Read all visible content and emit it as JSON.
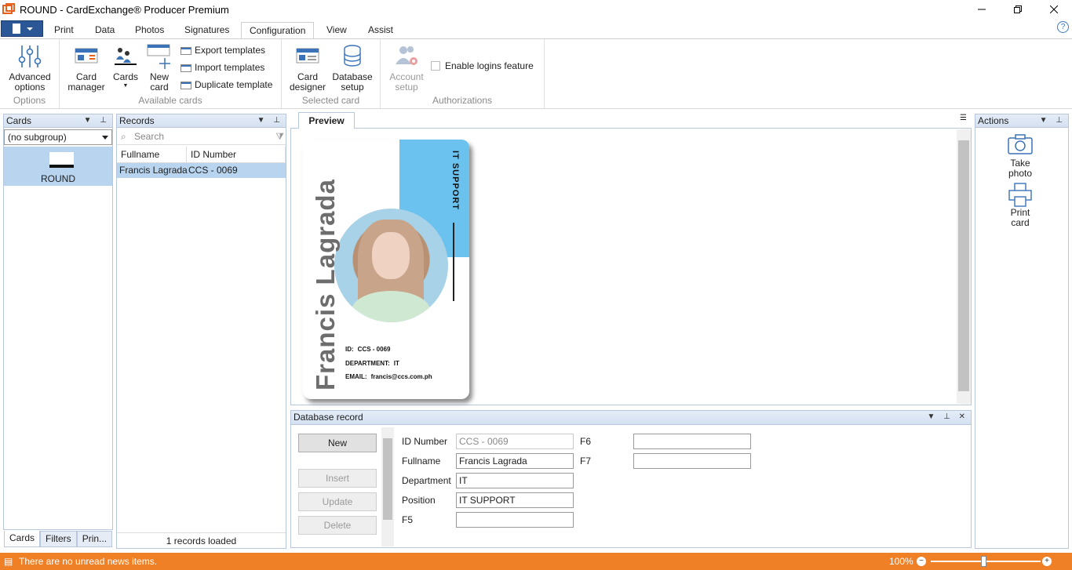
{
  "window": {
    "title": "ROUND - CardExchange® Producer Premium"
  },
  "tabs": [
    "Print",
    "Data",
    "Photos",
    "Signatures",
    "Configuration",
    "View",
    "Assist"
  ],
  "active_tab": "Configuration",
  "ribbon": {
    "options": {
      "advanced_line1": "Advanced",
      "advanced_line2": "options",
      "group": "Options"
    },
    "available_cards": {
      "card_manager_line1": "Card",
      "card_manager_line2": "manager",
      "cards": "Cards",
      "new_card_line1": "New",
      "new_card_line2": "card",
      "export": "Export templates",
      "import": "Import templates",
      "duplicate": "Duplicate template",
      "group": "Available cards"
    },
    "selected_card": {
      "designer_line1": "Card",
      "designer_line2": "designer",
      "db_line1": "Database",
      "db_line2": "setup",
      "group": "Selected card"
    },
    "authorizations": {
      "account_line1": "Account",
      "account_line2": "setup",
      "enable_logins": "Enable logins feature",
      "group": "Authorizations"
    }
  },
  "cards_pane": {
    "title": "Cards",
    "subgroup": "(no subgroup)",
    "card_name": "ROUND",
    "bottom_tabs": [
      "Cards",
      "Filters",
      "Prin..."
    ]
  },
  "records_pane": {
    "title": "Records",
    "search_placeholder": "Search",
    "columns": [
      "Fullname",
      "ID Number"
    ],
    "rows": [
      {
        "fullname": "Francis Lagrada",
        "id": "CCS - 0069"
      }
    ],
    "status": "1 records loaded"
  },
  "preview": {
    "tab": "Preview",
    "card": {
      "name": "Francis Lagrada",
      "role": "IT SUPPORT",
      "id_label": "ID:",
      "id_value": "CCS - 0069",
      "dept_label": "DEPARTMENT:",
      "dept_value": "IT",
      "email_label": "EMAIL:",
      "email_value": "francis@ccs.com.ph"
    }
  },
  "db_record": {
    "title": "Database record",
    "buttons": {
      "new": "New",
      "insert": "Insert",
      "update": "Update",
      "delete": "Delete"
    },
    "fields": {
      "id_label": "ID Number",
      "id_value": "CCS - 0069",
      "fullname_label": "Fullname",
      "fullname_value": "Francis Lagrada",
      "department_label": "Department",
      "department_value": "IT",
      "position_label": "Position",
      "position_value": "IT SUPPORT",
      "f5_label": "F5",
      "f6_label": "F6",
      "f7_label": "F7"
    }
  },
  "actions_pane": {
    "title": "Actions",
    "take_photo_line1": "Take",
    "take_photo_line2": "photo",
    "print_card_line1": "Print",
    "print_card_line2": "card"
  },
  "status": {
    "message": "There are no unread news items.",
    "zoom": "100%"
  },
  "colors": {
    "accent": "#2b5797",
    "status_bar": "#f08026",
    "card_blue": "#6cc2ef",
    "selection": "#b8d4ee"
  }
}
